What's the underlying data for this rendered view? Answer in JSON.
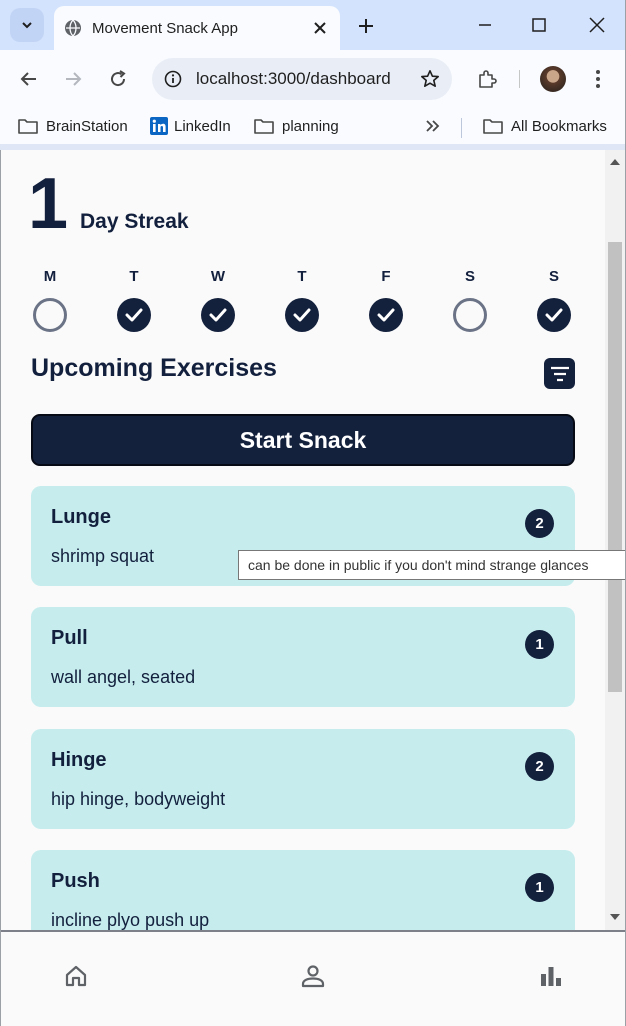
{
  "browser": {
    "tab_title": "Movement Snack App",
    "url": "localhost:3000/dashboard",
    "bookmarks": [
      "BrainStation",
      "LinkedIn",
      "planning"
    ],
    "all_bookmarks": "All Bookmarks"
  },
  "streak": {
    "count": "1",
    "label": "Day Streak",
    "days": [
      {
        "letter": "M",
        "done": false
      },
      {
        "letter": "T",
        "done": true
      },
      {
        "letter": "W",
        "done": true
      },
      {
        "letter": "T",
        "done": true
      },
      {
        "letter": "F",
        "done": true
      },
      {
        "letter": "S",
        "done": false
      },
      {
        "letter": "S",
        "done": true
      }
    ]
  },
  "upcoming": {
    "title": "Upcoming Exercises",
    "start_label": "Start Snack",
    "exercises": [
      {
        "title": "Lunge",
        "subtitle": "shrimp squat",
        "count": "2"
      },
      {
        "title": "Pull",
        "subtitle": "wall angel, seated",
        "count": "1"
      },
      {
        "title": "Hinge",
        "subtitle": "hip hinge, bodyweight",
        "count": "2"
      },
      {
        "title": "Push",
        "subtitle": "incline plyo push up",
        "count": "1"
      }
    ]
  },
  "tooltip": "can be done in public if you don't mind strange glances",
  "colors": {
    "navy": "#14213d",
    "card": "#c6ecee",
    "page": "#fafafa"
  }
}
